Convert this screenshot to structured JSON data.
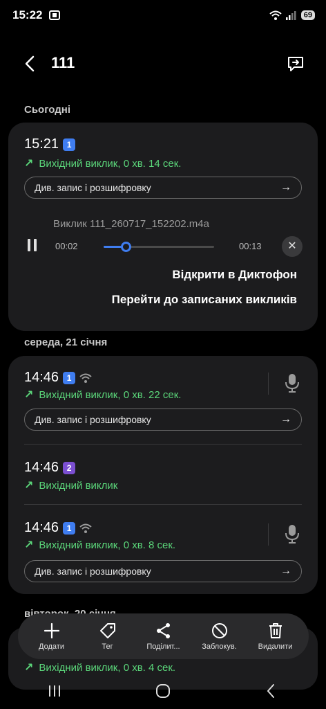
{
  "status": {
    "time": "15:22",
    "battery": "69"
  },
  "header": {
    "title": "111"
  },
  "sections": {
    "today": "Сьогодні",
    "wednesday": "середа, 21 січня",
    "tuesday": "вівторок, 20 січня"
  },
  "today_call": {
    "time": "15:21",
    "sim": "1",
    "type": "Вихідний виклик, 0 хв. 14 сек.",
    "transcript_label": "Див. запис і розшифровку",
    "player": {
      "file_name": "Виклик 111_260717_152202.m4a",
      "position": "00:02",
      "duration": "00:13",
      "progress": 0.2
    },
    "open_recorder": "Відкрити в Диктофон",
    "go_to_recordings": "Перейти до записаних викликів"
  },
  "wednesday_calls": [
    {
      "time": "14:46",
      "sim": "1",
      "type": "Вихідний виклик, 0 хв. 22 сек.",
      "transcript_label": "Див. запис і розшифровку"
    },
    {
      "time": "14:46",
      "sim": "2",
      "type": "Вихідний виклик"
    },
    {
      "time": "14:46",
      "sim": "1",
      "type": "Вихідний виклик, 0 хв. 8 сек.",
      "transcript_label": "Див. запис і розшифровку"
    }
  ],
  "tuesday_call": {
    "type": "Вихідний виклик, 0 хв. 4 сек."
  },
  "toolbar": {
    "add": "Додати",
    "tag": "Тег",
    "share": "Поділит...",
    "block": "Заблокув.",
    "delete": "Видалити"
  },
  "colors": {
    "accent": "#3f7df0",
    "outgoing": "#5bd67a",
    "card": "#1c1c1e",
    "sim2": "#7b4fd1"
  }
}
